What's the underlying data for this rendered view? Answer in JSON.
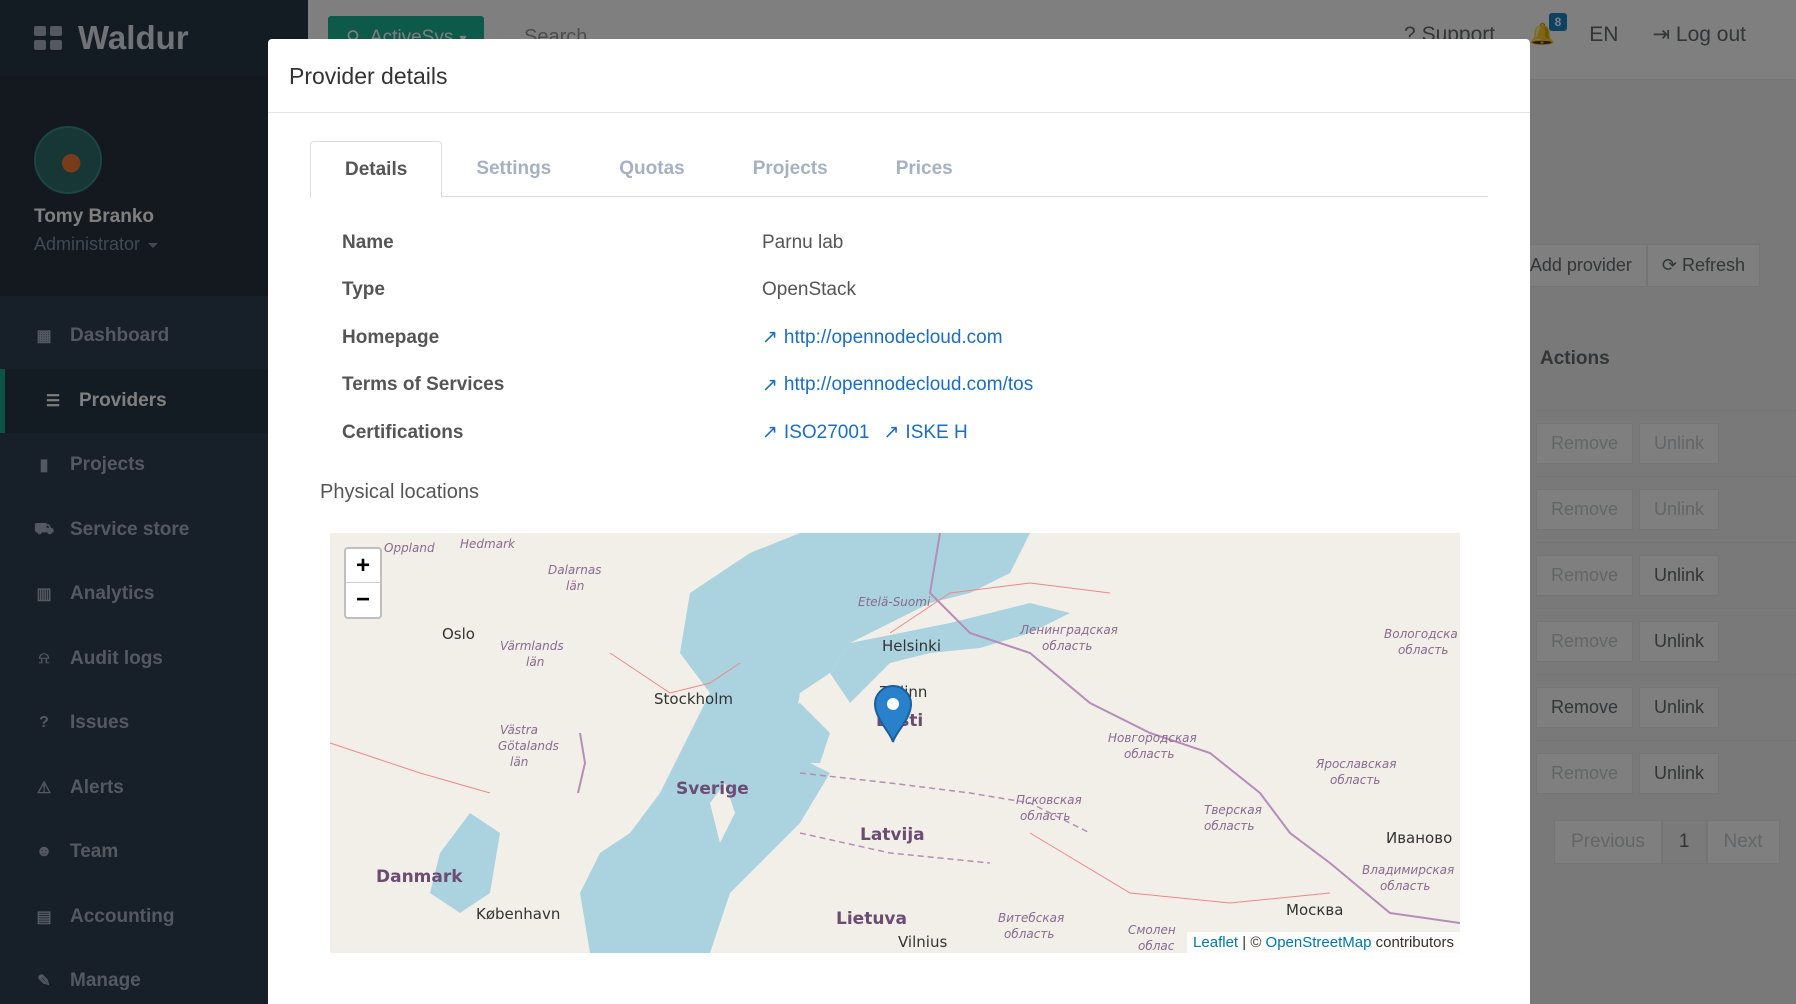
{
  "app": {
    "name": "Waldur"
  },
  "profile": {
    "name": "Tomy Branko",
    "role": "Administrator"
  },
  "nav": [
    {
      "label": "Dashboard",
      "icon": "dashboard-icon",
      "glyph": "▦"
    },
    {
      "label": "Providers",
      "icon": "database-icon",
      "glyph": "☰"
    },
    {
      "label": "Projects",
      "icon": "bookmark-icon",
      "glyph": "▮"
    },
    {
      "label": "Service store",
      "icon": "cart-icon",
      "glyph": "⛟"
    },
    {
      "label": "Analytics",
      "icon": "bar-chart-icon",
      "glyph": "▥"
    },
    {
      "label": "Audit logs",
      "icon": "bell-icon",
      "glyph": "⍾"
    },
    {
      "label": "Issues",
      "icon": "question-icon",
      "glyph": "?"
    },
    {
      "label": "Alerts",
      "icon": "pin-icon",
      "glyph": "⚠"
    },
    {
      "label": "Team",
      "icon": "users-icon",
      "glyph": "☻"
    },
    {
      "label": "Accounting",
      "icon": "file-icon",
      "glyph": "▤"
    },
    {
      "label": "Manage",
      "icon": "wrench-icon",
      "glyph": "✎"
    }
  ],
  "topbar": {
    "org": "ActiveSys",
    "search": "Search",
    "support": "Support",
    "notifications": "8",
    "lang": "EN",
    "logout": "Log out"
  },
  "background": {
    "add_provider": "Add provider",
    "refresh": "Refresh",
    "actions_header": "Actions",
    "remove": "Remove",
    "unlink": "Unlink",
    "previous": "Previous",
    "page": "1",
    "next": "Next"
  },
  "modal": {
    "title": "Provider details",
    "tabs": [
      "Details",
      "Settings",
      "Quotas",
      "Projects",
      "Prices"
    ],
    "details": {
      "name_label": "Name",
      "name": "Parnu lab",
      "type_label": "Type",
      "type": "OpenStack",
      "homepage_label": "Homepage",
      "homepage": "http://opennodecloud.com",
      "tos_label": "Terms of Services",
      "tos": "http://opennodecloud.com/tos",
      "cert_label": "Certifications",
      "cert1": "ISO27001",
      "cert2": "ISKE H"
    },
    "locations_title": "Physical locations"
  },
  "map": {
    "zoom_in": "+",
    "zoom_out": "−",
    "attribution_leaflet": "Leaflet",
    "attribution_sep": " | © ",
    "attribution_osm": "OpenStreetMap",
    "attribution_tail": " contributors",
    "labels": {
      "oppland": "Oppland",
      "hedmark": "Hedmark",
      "dalarnas": "Dalarnas",
      "lan1": "län",
      "oslo": "Oslo",
      "varmlands": "Värmlands",
      "lan2": "län",
      "stockholm": "Stockholm",
      "etela": "Etelä-Suomi",
      "helsinki": "Helsinki",
      "tallinn": "Tallinn",
      "eesti": "Eesti",
      "sverige": "Sverige",
      "vastra": "Västra",
      "gotalands": "Götalands",
      "lan3": "län",
      "danmark": "Danmark",
      "kobenhavn": "København",
      "latvija": "Latvija",
      "lietuva": "Lietuva",
      "vilnius": "Vilnius",
      "leningrad": "Ленинградская",
      "oblast1": "область",
      "novgorod": "Новгородская",
      "oblast2": "область",
      "pskov": "Псковская",
      "oblast3": "область",
      "tver": "Тверская",
      "oblast4": "область",
      "yaroslavl": "Ярославская",
      "oblast5": "область",
      "vologda": "Вологодска",
      "oblast6": "область",
      "ivanovo": "Иваново",
      "vladimir": "Владимирская",
      "oblast7": "область",
      "moskva": "Москва",
      "vitebsk": "Витебская",
      "oblast8": "область",
      "smolensk": "Смолен",
      "oblast9": "облас"
    }
  }
}
